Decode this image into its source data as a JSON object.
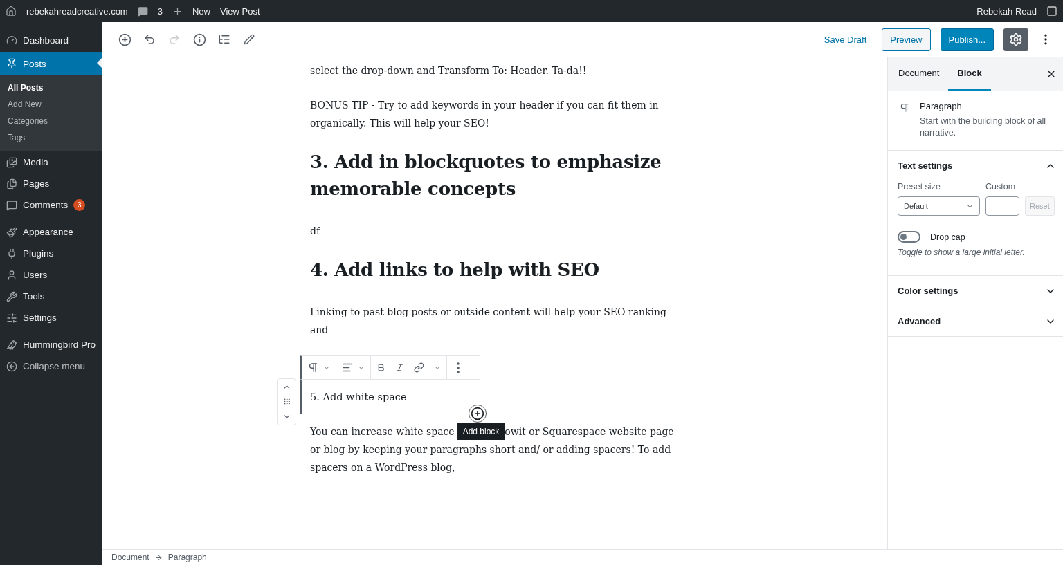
{
  "admin_bar": {
    "site": "rebekahreadcreative.com",
    "comments": "3",
    "new": "New",
    "view_post": "View Post",
    "user": "Rebekah Read"
  },
  "sidebar": {
    "items": [
      {
        "label": "Dashboard",
        "selected": false
      },
      {
        "label": "Posts",
        "selected": true,
        "children": [
          {
            "label": "All Posts",
            "selected": true
          },
          {
            "label": "Add New",
            "selected": false
          },
          {
            "label": "Categories",
            "selected": false
          },
          {
            "label": "Tags",
            "selected": false
          }
        ]
      },
      {
        "label": "Media",
        "selected": false
      },
      {
        "label": "Pages",
        "selected": false
      },
      {
        "label": "Comments",
        "selected": false,
        "badge": "3"
      },
      {
        "label": "Appearance",
        "selected": false
      },
      {
        "label": "Plugins",
        "selected": false
      },
      {
        "label": "Users",
        "selected": false
      },
      {
        "label": "Tools",
        "selected": false
      },
      {
        "label": "Settings",
        "selected": false
      },
      {
        "label": "Hummingbird Pro",
        "selected": false
      },
      {
        "label": "Collapse menu",
        "selected": false
      }
    ]
  },
  "toolbar": {
    "redo_disabled": true,
    "save_draft": "Save Draft",
    "preview": "Preview",
    "publish": "Publish...",
    "settings_selected": true
  },
  "blocks": [
    {
      "kind": "paragraph",
      "text": "select the drop-down and Transform To: Header. Ta-da!!"
    },
    {
      "kind": "paragraph",
      "text": "BONUS TIP - Try to add keywords in your header if you can fit them in organically. This will help your SEO!"
    },
    {
      "kind": "heading",
      "text": "3. Add in blockquotes to emphasize memorable concepts"
    },
    {
      "kind": "paragraph",
      "text": "df"
    },
    {
      "kind": "heading",
      "text": "4. Add links to help with SEO"
    },
    {
      "kind": "paragraph",
      "text": "Linking to past blog posts or outside content will help your SEO ranking and"
    },
    {
      "kind": "selected",
      "text": "5. Add white space"
    },
    {
      "kind": "covered",
      "text": "You can increase white space",
      "tooltip": "Add block",
      "after": "owit or Squarespace website page",
      "rest": "or blog by keeping your paragraphs short and/ or adding spacers! To add spacers on a WordPress blog,"
    }
  ],
  "settings": {
    "tabs": [
      {
        "label": "Document",
        "selected": false
      },
      {
        "label": "Block",
        "selected": true
      }
    ],
    "block": {
      "name": "Paragraph",
      "description": "Start with the building block of all narrative."
    },
    "panels": [
      {
        "title": "Text settings",
        "expanded": true,
        "preset_label": "Preset size",
        "preset_value": "Default",
        "custom_label": "Custom",
        "reset": "Reset",
        "drop_cap": {
          "label": "Drop cap",
          "on": false,
          "help": "Toggle to show a large initial letter."
        }
      },
      {
        "title": "Color settings",
        "expanded": false
      },
      {
        "title": "Advanced",
        "expanded": false
      }
    ]
  },
  "breadcrumb": [
    "Document",
    "Paragraph"
  ]
}
